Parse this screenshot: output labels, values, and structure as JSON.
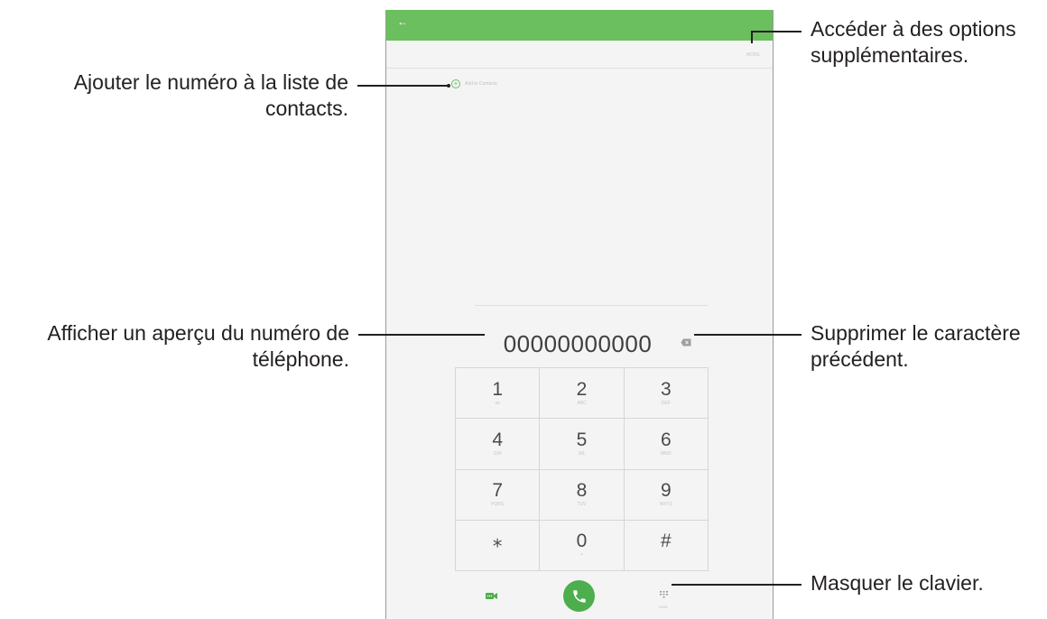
{
  "phone": {
    "appbar": {
      "back_icon": "back-arrow-icon"
    },
    "more_label": "MORE",
    "add_to_contacts_label": "Add to Contacts",
    "number": "00000000000",
    "keypad": [
      {
        "digit": "1",
        "letters": "ꝏ"
      },
      {
        "digit": "2",
        "letters": "ABC"
      },
      {
        "digit": "3",
        "letters": "DEF"
      },
      {
        "digit": "4",
        "letters": "GHI"
      },
      {
        "digit": "5",
        "letters": "JKL"
      },
      {
        "digit": "6",
        "letters": "MNO"
      },
      {
        "digit": "7",
        "letters": "PQRS"
      },
      {
        "digit": "8",
        "letters": "TUV"
      },
      {
        "digit": "9",
        "letters": "WXYZ"
      },
      {
        "digit": "⁎",
        "letters": ""
      },
      {
        "digit": "0",
        "letters": "+"
      },
      {
        "digit": "#",
        "letters": ""
      }
    ],
    "hide_label": "HIDE",
    "colors": {
      "accent": "#6bbf5e",
      "call": "#4cae4c"
    }
  },
  "callouts": {
    "add_contact": {
      "line1": "Ajouter le numéro à la liste de",
      "line2": "contacts."
    },
    "preview": {
      "line1": "Afficher un aperçu du numéro de",
      "line2": "téléphone."
    },
    "more_options": {
      "line1": "Accéder à des options",
      "line2": "supplémentaires."
    },
    "delete_char": {
      "line1": "Supprimer le caractère",
      "line2": "précédent."
    },
    "hide_keypad": {
      "line1": "Masquer le clavier."
    }
  }
}
